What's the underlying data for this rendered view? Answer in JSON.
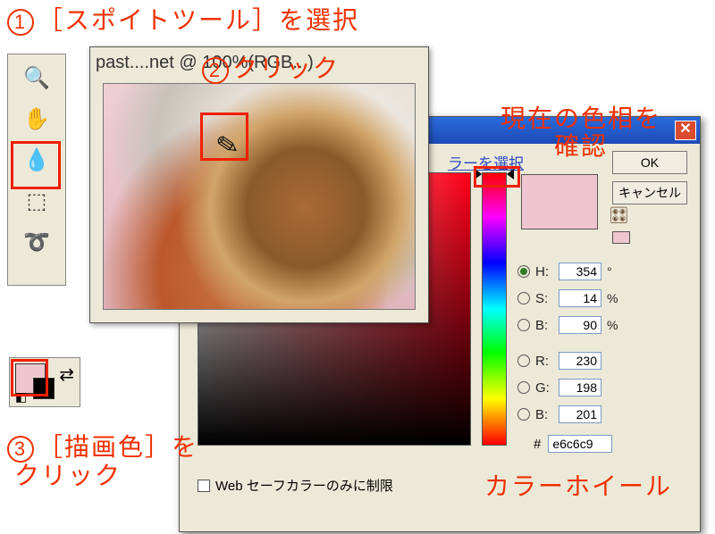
{
  "annotations": {
    "step1": "［スポイトツール］を選択",
    "step2": "クリック",
    "step3a": "［描画色］を",
    "step3b": "クリック",
    "confirm_a": "現在の色相を",
    "confirm_b": "確認",
    "wheel": "カラーホイール",
    "n1": "1",
    "n2": "2",
    "n3": "3"
  },
  "toolbox": {
    "tool_zoom": "🔍",
    "tool_hand": "✋",
    "tool_eyedrop": "💧",
    "tool_marquee": "⬚",
    "tool_lasso": "➰"
  },
  "document": {
    "title": "past....net @ 100%(RGB...)",
    "cursor_glyph": "✎"
  },
  "swatches": {
    "swap": "⇄",
    "mini": "◧"
  },
  "picker": {
    "link": "ラーを選択",
    "ok": "OK",
    "cancel": "キャンセル",
    "cube": "🎛",
    "rows": {
      "H": {
        "label": "H:",
        "value": "354",
        "unit": "°"
      },
      "S": {
        "label": "S:",
        "value": "14",
        "unit": "%"
      },
      "Bv": {
        "label": "B:",
        "value": "90",
        "unit": "%"
      },
      "R": {
        "label": "R:",
        "value": "230",
        "unit": ""
      },
      "G": {
        "label": "G:",
        "value": "198",
        "unit": ""
      },
      "B": {
        "label": "B:",
        "value": "201",
        "unit": ""
      }
    },
    "hex_label": "#",
    "hex_value": "e6c6c9",
    "websafe": "Web セーフカラーのみに制限"
  }
}
